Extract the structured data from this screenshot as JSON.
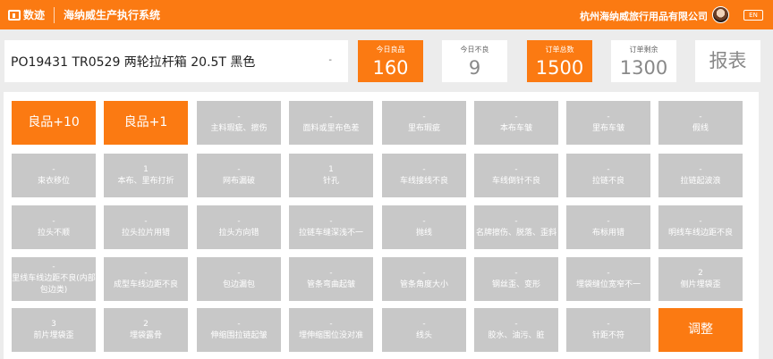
{
  "header": {
    "logo_text": "数迹",
    "system_title": "海纳威生产执行系统",
    "company": "杭州海纳威旅行用品有限公司",
    "lang": "EN",
    "brand_color": "#fb7a12"
  },
  "order": {
    "text": "PO19431 TR0529 两轮拉杆箱 20.5T 黑色",
    "caret": "-"
  },
  "stats": [
    {
      "label": "今日良品",
      "value": "160"
    },
    {
      "label": "今日不良",
      "value": "9"
    },
    {
      "label": "订单总数",
      "value": "1500"
    },
    {
      "label": "订单剩余",
      "value": "1300"
    }
  ],
  "report_label": "报表",
  "actions": {
    "good10": "良品+10",
    "good1": "良品+1",
    "adjust": "调整"
  },
  "defects": [
    {
      "count": "-",
      "label": "主料瑕疵、擦伤"
    },
    {
      "count": "-",
      "label": "面料或里布色差"
    },
    {
      "count": "-",
      "label": "里布瑕疵"
    },
    {
      "count": "-",
      "label": "本布车皱"
    },
    {
      "count": "-",
      "label": "里布车皱"
    },
    {
      "count": "-",
      "label": "假线"
    },
    {
      "count": "-",
      "label": "束衣移位"
    },
    {
      "count": "1",
      "label": "本布、里布打折"
    },
    {
      "count": "-",
      "label": "网布漏破"
    },
    {
      "count": "1",
      "label": "针孔"
    },
    {
      "count": "-",
      "label": "车线接线不良"
    },
    {
      "count": "-",
      "label": "车线倒针不良"
    },
    {
      "count": "-",
      "label": "拉链不良"
    },
    {
      "count": "-",
      "label": "拉链起波浪"
    },
    {
      "count": "-",
      "label": "拉头不顺"
    },
    {
      "count": "-",
      "label": "拉头拉片用错"
    },
    {
      "count": "-",
      "label": "拉头方向错"
    },
    {
      "count": "-",
      "label": "拉链车缝深浅不一"
    },
    {
      "count": "-",
      "label": "抛线"
    },
    {
      "count": "-",
      "label": "名牌擦伤、脱落、歪斜"
    },
    {
      "count": "-",
      "label": "布标用错"
    },
    {
      "count": "-",
      "label": "明线车线边距不良"
    },
    {
      "count": "-",
      "label": "里线车线边距不良(内部包边类)"
    },
    {
      "count": "-",
      "label": "成型车线边距不良"
    },
    {
      "count": "-",
      "label": "包边漏包"
    },
    {
      "count": "-",
      "label": "管条弯曲起皱"
    },
    {
      "count": "-",
      "label": "管条角度大小"
    },
    {
      "count": "-",
      "label": "钢丝歪、变形"
    },
    {
      "count": "-",
      "label": "埋袋缝位宽窄不一"
    },
    {
      "count": "2",
      "label": "侧片埋袋歪"
    },
    {
      "count": "3",
      "label": "前片埋袋歪"
    },
    {
      "count": "2",
      "label": "埋袋露骨"
    },
    {
      "count": "-",
      "label": "伸缩围拉链起皱"
    },
    {
      "count": "-",
      "label": "埋伸缩围位没对准"
    },
    {
      "count": "-",
      "label": "线头"
    },
    {
      "count": "-",
      "label": "胶水、油污、脏"
    },
    {
      "count": "-",
      "label": "针距不符"
    }
  ]
}
